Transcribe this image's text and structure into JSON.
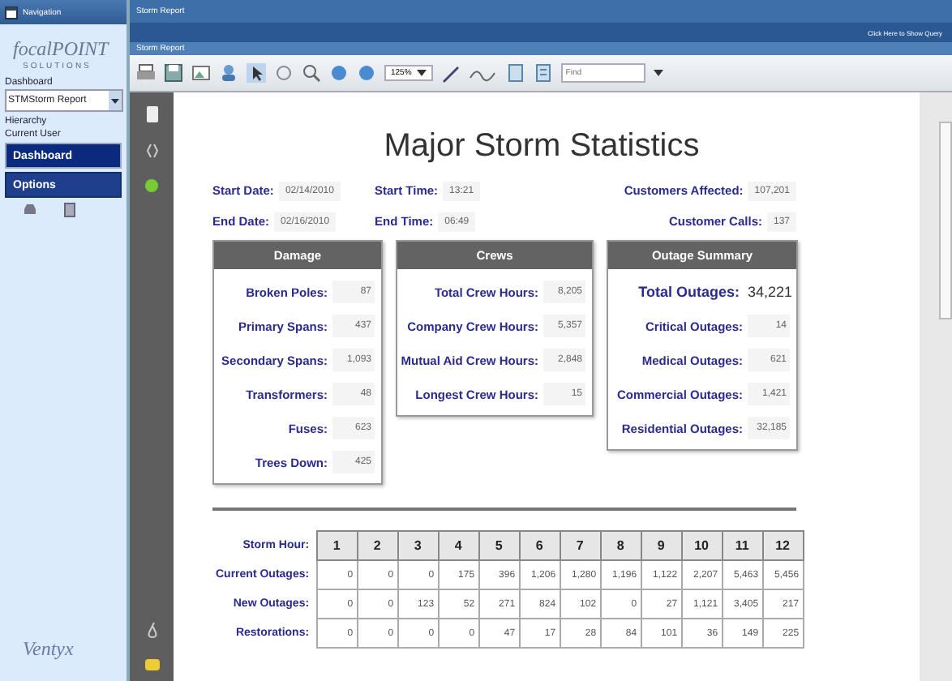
{
  "nav": {
    "title": "Navigation",
    "logo": "focalPOINT",
    "logo_sub": "SOLUTIONS",
    "dashboard_label": "Dashboard",
    "report_select": "STMStorm Report",
    "hierarchy_label": "Hierarchy",
    "user_label": "Current User",
    "buttons": [
      {
        "label": "Dashboard",
        "selected": true
      },
      {
        "label": "Options",
        "selected": false
      }
    ],
    "footer_logo": "Ventyx"
  },
  "window": {
    "title": "Storm Report",
    "query_link": "Click Here to Show Query",
    "subtitle": "Storm Report"
  },
  "toolbar": {
    "zoom": "125%",
    "find_placeholder": "Find"
  },
  "report": {
    "title": "Major Storm Statistics",
    "info": [
      {
        "label": "Start Date:",
        "value": "02/14/2010"
      },
      {
        "label": "Start Time:",
        "value": "13:21"
      },
      {
        "label": "Customers Affected:",
        "value": "107,201"
      },
      {
        "label": "End Date:",
        "value": "02/16/2010"
      },
      {
        "label": "End Time:",
        "value": "06:49"
      },
      {
        "label": "Customer Calls:",
        "value": "137"
      }
    ],
    "panels": [
      {
        "title": "Damage",
        "rows": [
          {
            "label": "Broken Poles:",
            "value": "87"
          },
          {
            "label": "Primary Spans:",
            "value": "437"
          },
          {
            "label": "Secondary Spans:",
            "value": "1,093"
          },
          {
            "label": "Transformers:",
            "value": "48"
          },
          {
            "label": "Fuses:",
            "value": "623"
          },
          {
            "label": "Trees Down:",
            "value": "425"
          }
        ]
      },
      {
        "title": "Crews",
        "rows": [
          {
            "label": "Total Crew Hours:",
            "value": "8,205"
          },
          {
            "label": "Company Crew Hours:",
            "value": "5,357"
          },
          {
            "label": "Mutual Aid Crew Hours:",
            "value": "2,848"
          },
          {
            "label": "Longest Crew Hours:",
            "value": "15"
          }
        ]
      },
      {
        "title": "Outage Summary",
        "rows": [
          {
            "label": "Total Outages:",
            "value": "34,221",
            "emphasis": true
          },
          {
            "label": "Critical Outages:",
            "value": "14",
            "emphasis": false
          },
          {
            "label": "Medical Outages:",
            "value": "621",
            "emphasis": false
          },
          {
            "label": "Commercial Outages:",
            "value": "1,421",
            "emphasis": false
          },
          {
            "label": "Residential Outages:",
            "value": "32,185",
            "emphasis": false
          }
        ]
      }
    ],
    "hours": {
      "label": "Storm Hour:",
      "columns": [
        "1",
        "2",
        "3",
        "4",
        "5",
        "6",
        "7",
        "8",
        "9",
        "10",
        "11",
        "12"
      ],
      "rows": [
        {
          "label": "Current Outages:",
          "values": [
            "0",
            "0",
            "0",
            "175",
            "396",
            "1,206",
            "1,280",
            "1,196",
            "1,122",
            "2,207",
            "5,463",
            "5,456"
          ]
        },
        {
          "label": "New Outages:",
          "values": [
            "0",
            "0",
            "123",
            "52",
            "271",
            "824",
            "102",
            "0",
            "27",
            "1,121",
            "3,405",
            "217"
          ]
        },
        {
          "label": "Restorations:",
          "values": [
            "0",
            "0",
            "0",
            "0",
            "47",
            "17",
            "28",
            "84",
            "101",
            "36",
            "149",
            "225"
          ]
        }
      ]
    }
  }
}
